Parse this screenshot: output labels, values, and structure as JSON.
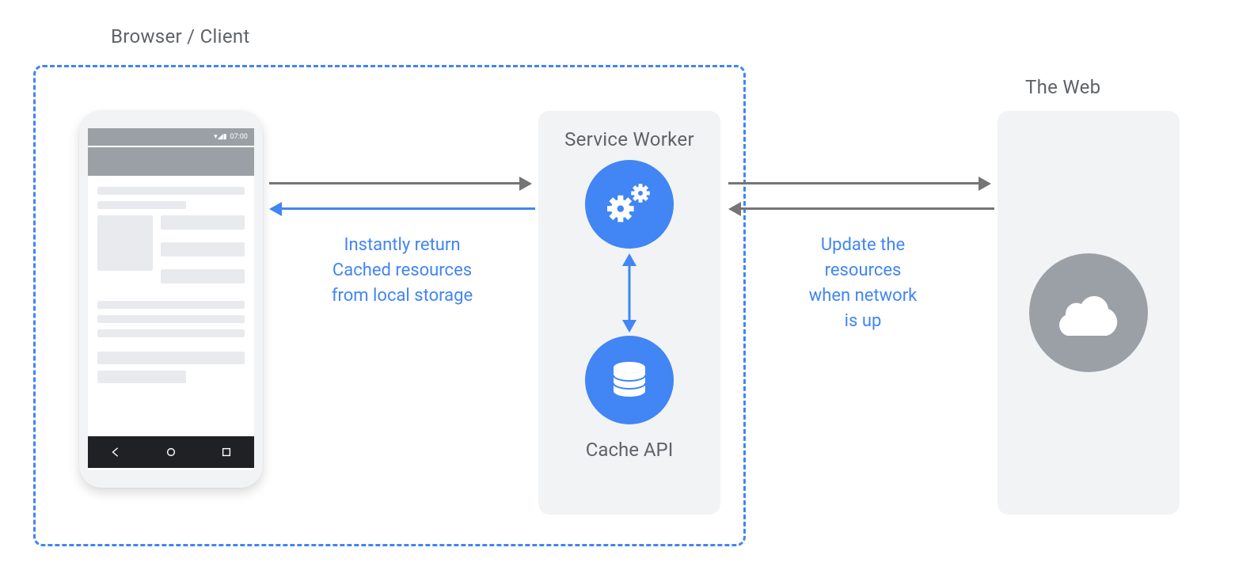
{
  "labels": {
    "browser_client": "Browser / Client",
    "service_worker": "Service Worker",
    "cache_api": "Cache API",
    "the_web": "The Web"
  },
  "phone": {
    "status_time": "07:00"
  },
  "captions": {
    "cached_line1": "Instantly return",
    "cached_line2": "Cached resources",
    "cached_line3": "from local storage",
    "update_line1": "Update the",
    "update_line2": "resources",
    "update_line3": "when network",
    "update_line4": "is up"
  },
  "icons": {
    "gears": "gears-icon",
    "database": "database-icon",
    "cloud": "cloud-icon"
  },
  "colors": {
    "blue": "#4285f4",
    "grey_fill": "#f1f3f4",
    "grey_stroke": "#757575",
    "grey_dark": "#9aa0a6",
    "text": "#5f6368"
  }
}
